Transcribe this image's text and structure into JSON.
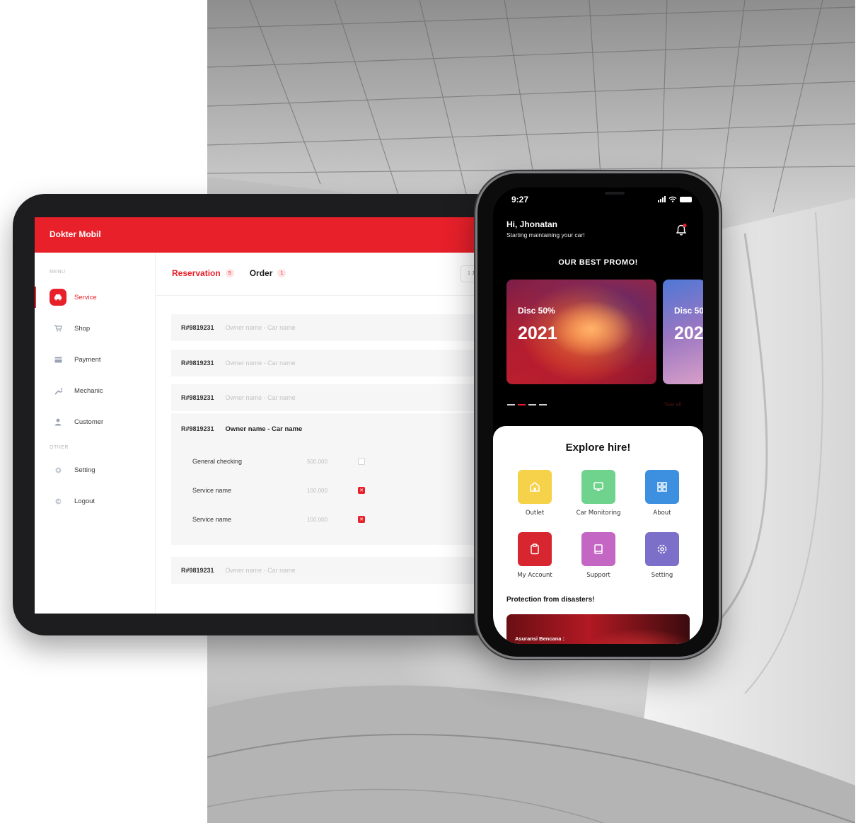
{
  "tablet": {
    "brand": "Dokter Mobil",
    "menu_section": "MENU",
    "other_section": "OTHER",
    "menu_items": [
      {
        "label": "Service",
        "icon": "car-icon",
        "active": true
      },
      {
        "label": "Shop",
        "icon": "cart-icon",
        "active": false
      },
      {
        "label": "Payment",
        "icon": "card-icon",
        "active": false
      },
      {
        "label": "Mechanic",
        "icon": "wrench-icon",
        "active": false
      },
      {
        "label": "Customer",
        "icon": "user-icon",
        "active": false
      }
    ],
    "other_items": [
      {
        "label": "Setting",
        "icon": "gear-icon"
      },
      {
        "label": "Logout",
        "icon": "logout-icon"
      }
    ],
    "tabs": [
      {
        "label": "Reservation",
        "badge": "5",
        "active": true
      },
      {
        "label": "Order",
        "badge": "1",
        "active": false
      }
    ],
    "date_filter": "1 Ja",
    "rows": [
      {
        "code": "R#9819231",
        "owner": "Owner name - Car name"
      },
      {
        "code": "R#9819231",
        "owner": "Owner name - Car name"
      },
      {
        "code": "R#9819231",
        "owner": "Owner name - Car name"
      }
    ],
    "expanded": {
      "code": "R#9819231",
      "owner": "Owner name - Car name",
      "services": [
        {
          "name": "General checking",
          "price": "500.000",
          "checked": false
        },
        {
          "name": "Service name",
          "price": "100.000",
          "checked": true
        },
        {
          "name": "Service name",
          "price": "100.000",
          "checked": true
        }
      ]
    },
    "last_row": {
      "code": "R#9819231",
      "owner": "Owner name - Car name"
    },
    "accent_color": "#e8202a"
  },
  "phone": {
    "time": "9:27",
    "greeting": "Hi, Jhonatan",
    "subtitle": "Starting maintaining your car!",
    "promo_title": "OUR BEST PROMO!",
    "promos": [
      {
        "disc": "Disc 50%",
        "year": "2021"
      },
      {
        "disc": "Disc 50",
        "year": "202"
      }
    ],
    "see_all": "See all",
    "explore_title": "Explore hire!",
    "tiles": [
      {
        "label": "Outlet",
        "icon": "home-icon",
        "color": "#f5d24a"
      },
      {
        "label": "Car Monitoring",
        "icon": "monitor-icon",
        "color": "#6fd38d"
      },
      {
        "label": "About",
        "icon": "grid-icon",
        "color": "#3d8fe0"
      },
      {
        "label": "My Account",
        "icon": "clipboard-icon",
        "color": "#d7262f"
      },
      {
        "label": "Support",
        "icon": "book-icon",
        "color": "#c466c4"
      },
      {
        "label": "Setting",
        "icon": "gear-icon",
        "color": "#7b6fc9"
      }
    ],
    "protection_title": "Protection from disasters!",
    "banner_text": "Asuransi Bencana :"
  }
}
